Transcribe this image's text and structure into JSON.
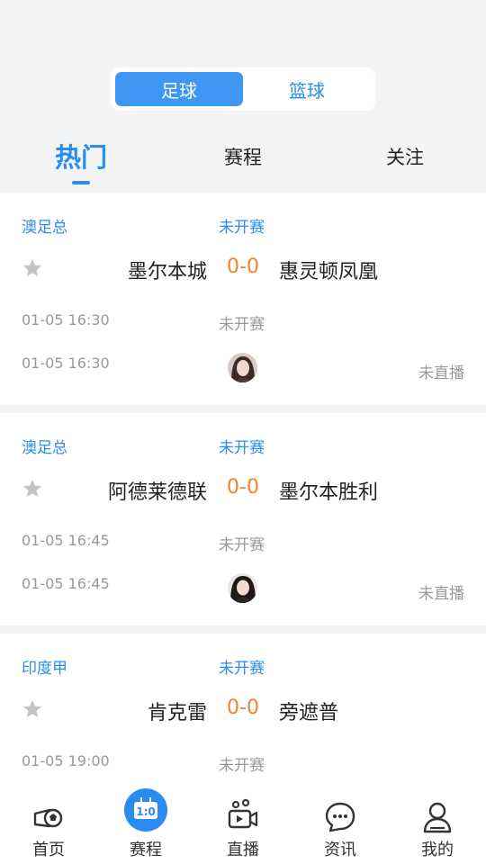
{
  "sport_switch": {
    "football": "足球",
    "basketball": "篮球",
    "active": "football"
  },
  "tabs": {
    "hot": "热门",
    "schedule": "赛程",
    "follow": "关注"
  },
  "matches": [
    {
      "league": "澳足总",
      "status": "未开赛",
      "home": "墨尔本城",
      "score": "0-0",
      "away": "惠灵顿凤凰",
      "time": "01-05 16:30",
      "stream_time": "01-05 16:30",
      "live_status": "未直播"
    },
    {
      "league": "澳足总",
      "status": "未开赛",
      "home": "阿德莱德联",
      "score": "0-0",
      "away": "墨尔本胜利",
      "time": "01-05 16:45",
      "stream_time": "01-05 16:45",
      "live_status": "未直播"
    },
    {
      "league": "印度甲",
      "status": "未开赛",
      "home": "肯克雷",
      "score": "0-0",
      "away": "旁遮普",
      "time": "01-05 19:00"
    }
  ],
  "bottom_nav": {
    "home": "首页",
    "schedule": "赛程",
    "live": "直播",
    "news": "资讯",
    "mine": "我的"
  },
  "colors": {
    "accent": "#2a8cf0",
    "score": "#f5822a",
    "muted": "#999999",
    "background": "#f3f4f6"
  }
}
